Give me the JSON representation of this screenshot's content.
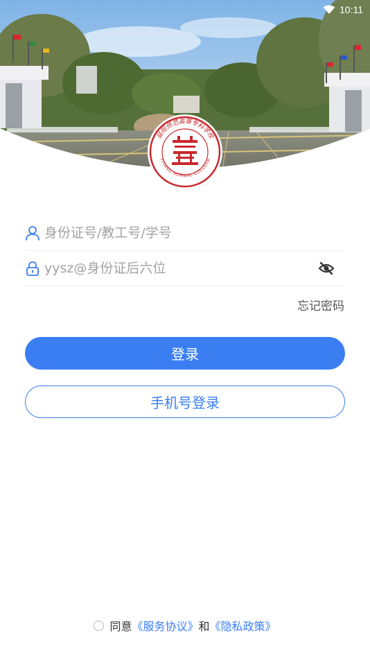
{
  "status_bar": {
    "time": "10:11",
    "wifi_icon": "wifi-icon"
  },
  "header": {
    "seal_text_top": "益阳师范高等专科学校",
    "seal_text_bottom": "YIYANG NORMAL COLLEGE",
    "seal_glyph": "益师"
  },
  "form": {
    "account": {
      "placeholder": "身份证号/教工号/学号",
      "icon": "user-icon",
      "value": ""
    },
    "password": {
      "placeholder": "yysz@身份证后六位",
      "icon": "lock-icon",
      "toggle_icon": "eye-hidden-icon",
      "value": ""
    },
    "forgot_password": "忘记密码"
  },
  "buttons": {
    "login": "登录",
    "phone_login": "手机号登录"
  },
  "agreement": {
    "prefix": "同意",
    "service_link": "《服务协议》",
    "conjunction": "和",
    "privacy_link": "《隐私政策》"
  },
  "colors": {
    "accent": "#3a7ef2",
    "seal_red": "#c8282d",
    "text_muted": "#a2a2a2"
  }
}
